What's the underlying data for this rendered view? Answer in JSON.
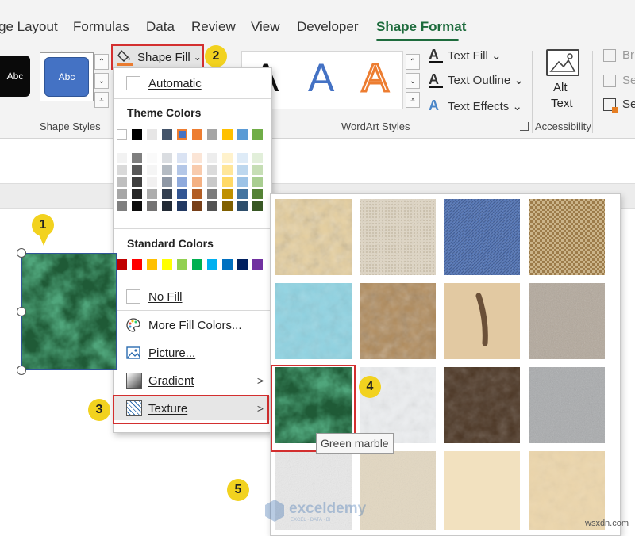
{
  "tabs": [
    "ge Layout",
    "Formulas",
    "Data",
    "Review",
    "View",
    "Developer",
    "Shape Format"
  ],
  "active_tab": "Shape Format",
  "shape_styles": {
    "thumb_label_dark": "Abc",
    "thumb_label_blue": "Abc",
    "group_label": "Shape Styles"
  },
  "shape_fill": {
    "label": "Shape Fill",
    "caret": "⌄"
  },
  "wordart": {
    "letters": [
      "A",
      "A",
      "A"
    ],
    "text_fill": "Text Fill",
    "text_outline": "Text Outline",
    "text_effects": "Text Effects",
    "group_label": "WordArt Styles"
  },
  "accessibility": {
    "alt_text_line1": "Alt",
    "alt_text_line2": "Text",
    "group_label": "Accessibility"
  },
  "arrange_partial": [
    "Br",
    "Se",
    "Se"
  ],
  "menu": {
    "automatic": "Automatic",
    "theme_colors_heading": "Theme Colors",
    "standard_colors_heading": "Standard Colors",
    "no_fill": "No Fill",
    "more_fill_colors": "More Fill Colors...",
    "picture": "Picture...",
    "gradient": "Gradient",
    "texture": "Texture",
    "theme_colors": [
      "#ffffff",
      "#000000",
      "#e7e6e6",
      "#44546a",
      "#4472c4",
      "#ed7d31",
      "#a5a5a5",
      "#ffc000",
      "#5b9bd5",
      "#70ad47"
    ],
    "standard_colors": [
      "#c00000",
      "#ff0000",
      "#ffc000",
      "#ffff00",
      "#92d050",
      "#00b050",
      "#00b0f0",
      "#0070c0",
      "#002060",
      "#7030a0"
    ]
  },
  "tooltip": "Green marble",
  "badges": [
    "1",
    "2",
    "3",
    "4",
    "5"
  ],
  "watermark": {
    "brand": "exceldemy",
    "tagline": "EXCEL · DATA · BI",
    "site": "wsxdn.com"
  },
  "colors": {
    "accent_tab": "#1d6b3c",
    "highlight_border": "#d32f2f",
    "badge": "#f2d21f"
  }
}
